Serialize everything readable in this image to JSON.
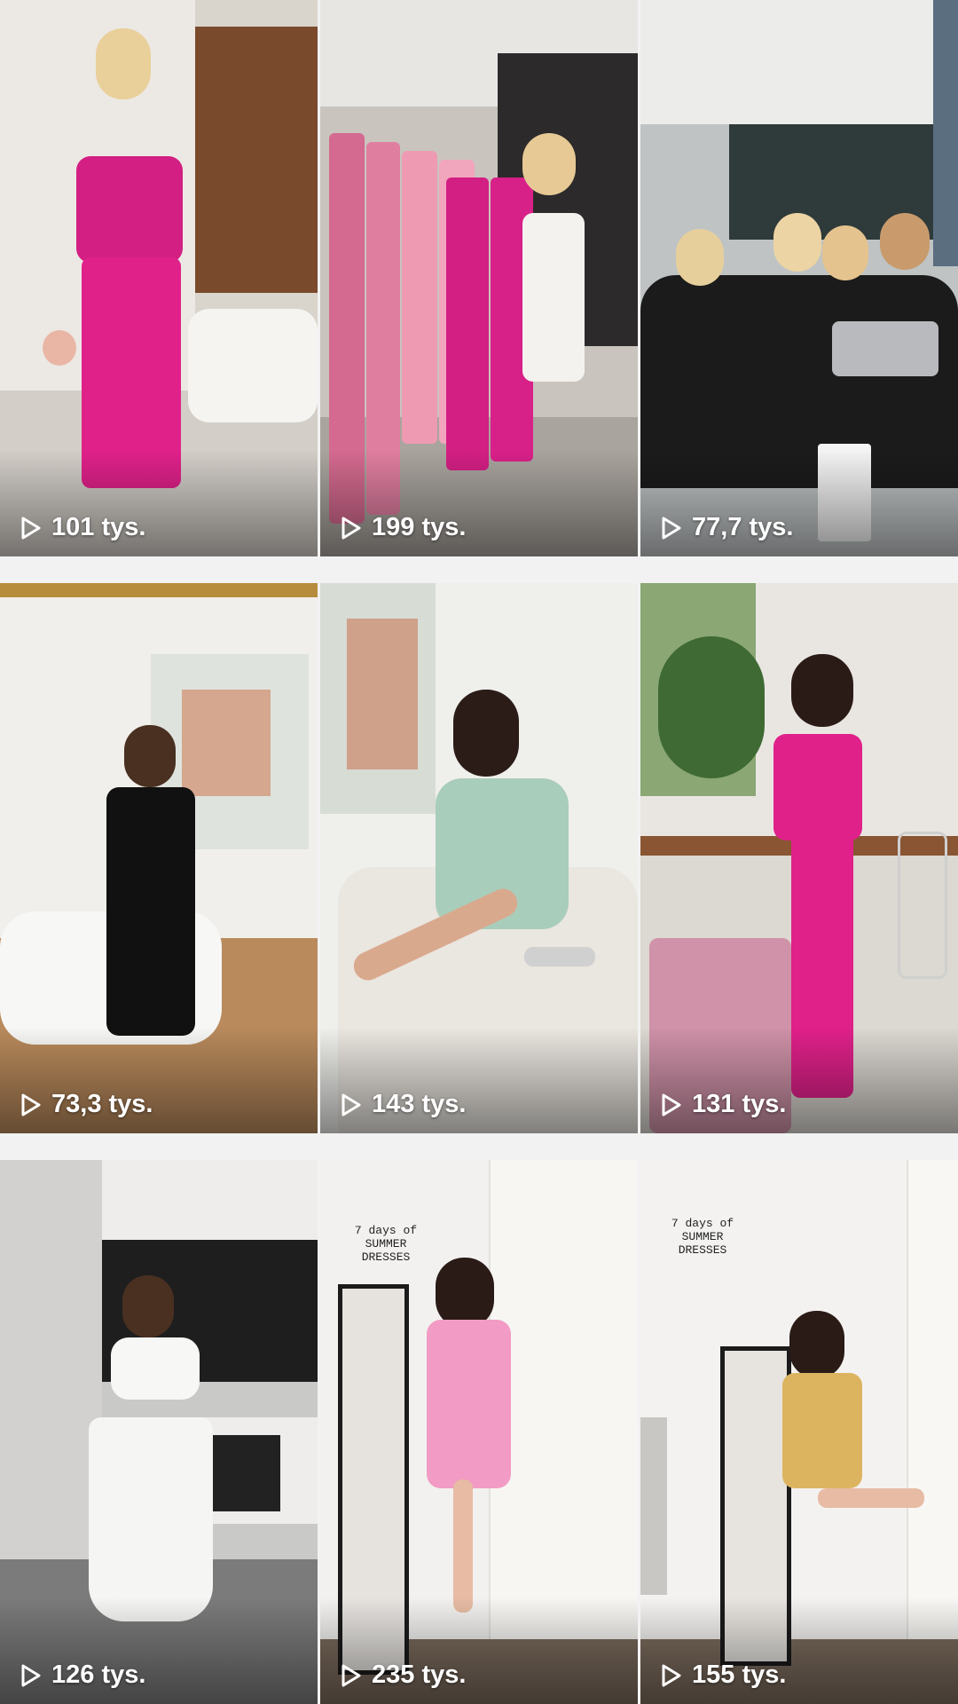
{
  "reels": [
    {
      "views": "101 tys.",
      "play_icon": "play-icon",
      "caption": ""
    },
    {
      "views": "199 tys.",
      "play_icon": "play-icon",
      "caption": ""
    },
    {
      "views": "77,7 tys.",
      "play_icon": "play-icon",
      "caption": ""
    },
    {
      "views": "73,3 tys.",
      "play_icon": "play-icon",
      "caption": ""
    },
    {
      "views": "143 tys.",
      "play_icon": "play-icon",
      "caption": ""
    },
    {
      "views": "131 tys.",
      "play_icon": "play-icon",
      "caption": ""
    },
    {
      "views": "126 tys.",
      "play_icon": "play-icon",
      "caption": ""
    },
    {
      "views": "235 tys.",
      "play_icon": "play-icon",
      "caption": "7 days of\nSUMMER\nDRESSES"
    },
    {
      "views": "155 tys.",
      "play_icon": "play-icon",
      "caption": "7 days of\nSUMMER\nDRESSES"
    }
  ],
  "colors": {
    "background": "#f2f2f2",
    "overlay_text": "#ffffff",
    "accent_pink": "#e0218a"
  }
}
